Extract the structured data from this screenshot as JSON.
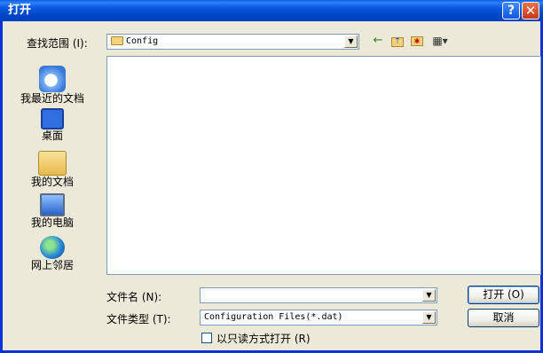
{
  "window": {
    "title": "打开",
    "help_label": "?",
    "close_label": "✕"
  },
  "lookin": {
    "label": "查找范围 (I):",
    "value": "Config"
  },
  "toolbar": {
    "back_glyph": "←",
    "up_glyph": "⇡",
    "newfolder_glyph": "✱",
    "views_glyph": "▦▾"
  },
  "places": [
    {
      "label": "我最近的文档",
      "icon": "recent-documents-icon"
    },
    {
      "label": "桌面",
      "icon": "desktop-icon"
    },
    {
      "label": "我的文档",
      "icon": "my-documents-icon"
    },
    {
      "label": "我的电脑",
      "icon": "my-computer-icon"
    },
    {
      "label": "网上邻居",
      "icon": "network-places-icon"
    }
  ],
  "filename": {
    "label": "文件名 (N):",
    "value": ""
  },
  "filetype": {
    "label": "文件类型 (T):",
    "value": "Configuration Files(*.dat)"
  },
  "readonly": {
    "label": "以只读方式打开 (R)",
    "checked": false
  },
  "buttons": {
    "open": "打开 (O)",
    "cancel": "取消"
  },
  "colors": {
    "titlebar": "#0054e3",
    "face": "#ece9d8",
    "border": "#7f9db9"
  }
}
